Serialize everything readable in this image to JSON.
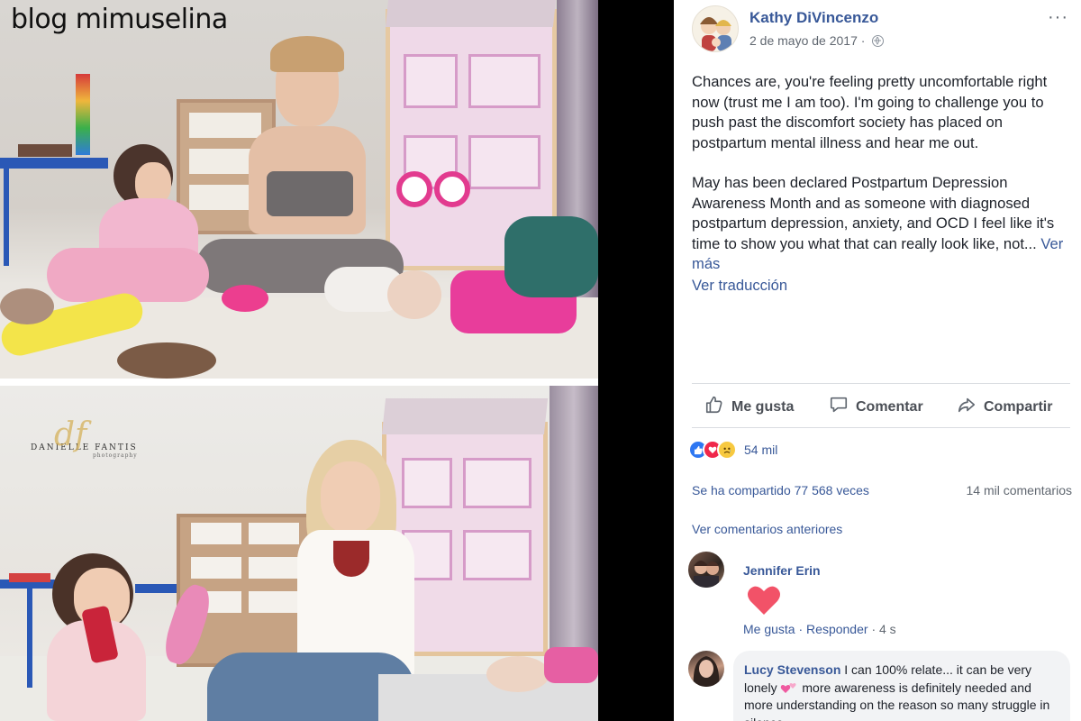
{
  "watermark": {
    "blog_title": "blog mimuselina",
    "photographer_name": "DANIELLE FANTIS",
    "photographer_role": "photography",
    "monogram": "df"
  },
  "post": {
    "author": "Kathy DiVincenzo",
    "date": "2 de mayo de 2017 ·",
    "more_icon": "···",
    "paragraph1": "Chances are, you're feeling pretty uncomfortable right now (trust me I am too). I'm going to challenge you to push past the discomfort society has placed on postpartum mental illness and hear me out.",
    "paragraph2": "May has been declared Postpartum Depression Awareness Month and as someone with diagnosed postpartum depression, anxiety, and OCD I feel like it's time to show you what that can really look like, not...",
    "see_more": "Ver más",
    "see_translation": "Ver traducción"
  },
  "actions": {
    "like": "Me gusta",
    "comment": "Comentar",
    "share": "Compartir"
  },
  "stats": {
    "reactions_count": "54 mil",
    "shares": "Se ha compartido 77 568 veces",
    "comments": "14 mil comentarios",
    "previous_comments": "Ver comentarios anteriores"
  },
  "comments": [
    {
      "name": "Jennifer Erin",
      "like_label": "Me gusta",
      "reply_label": "Responder",
      "time": "4 s"
    },
    {
      "name": "Lucy Stevenson",
      "text_before_emoji": "I can 100% relate... it can be very lonely",
      "text_after_emoji": " more awareness is definitely needed and more understanding on the reason so many struggle in silence"
    }
  ],
  "colors": {
    "link": "#385898",
    "like_reaction": "#2e77f2",
    "love_reaction": "#f0284a",
    "sad_reaction": "#f7c940",
    "heart_comment": "#f25268"
  }
}
